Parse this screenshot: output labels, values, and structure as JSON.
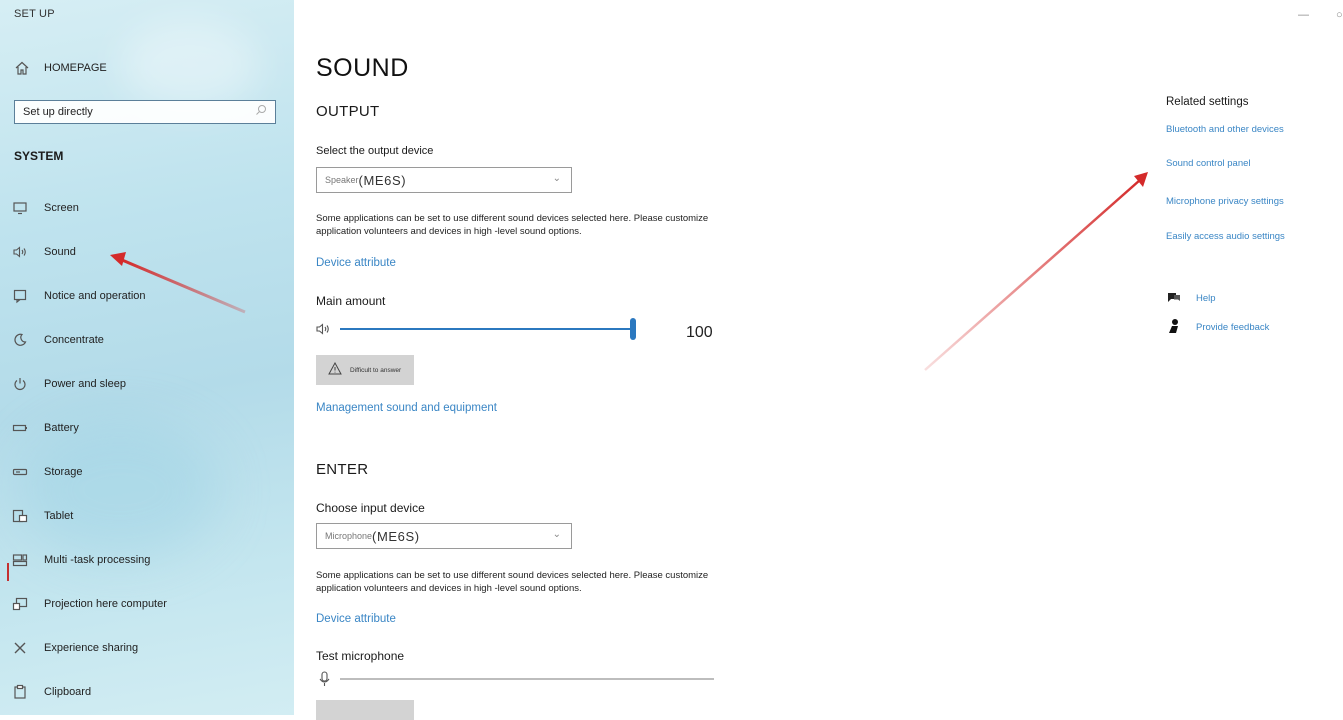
{
  "window": {
    "title": "SET UP",
    "minimize": "—",
    "close": "○"
  },
  "sidebar": {
    "home_label": "HOMEPAGE",
    "search": {
      "placeholder": "Set up directly"
    },
    "section": "SYSTEM",
    "items": [
      {
        "label": "Screen",
        "icon": "monitor-icon"
      },
      {
        "label": "Sound",
        "icon": "speaker-icon"
      },
      {
        "label": "Notice and operation",
        "icon": "notification-icon"
      },
      {
        "label": "Concentrate",
        "icon": "moon-icon"
      },
      {
        "label": "Power and sleep",
        "icon": "power-icon"
      },
      {
        "label": "Battery",
        "icon": "battery-icon"
      },
      {
        "label": "Storage",
        "icon": "storage-icon"
      },
      {
        "label": "Tablet",
        "icon": "tablet-icon"
      },
      {
        "label": "Multi -task processing",
        "icon": "multitask-icon"
      },
      {
        "label": "Projection here computer",
        "icon": "projection-icon"
      },
      {
        "label": "Experience sharing",
        "icon": "share-icon"
      },
      {
        "label": "Clipboard",
        "icon": "clipboard-icon"
      }
    ]
  },
  "main": {
    "title": "SOUND",
    "output": {
      "heading": "OUTPUT",
      "select_label": "Select the output device",
      "device_prefix": "Speaker",
      "device_model": "(ME6S)",
      "description": "Some applications can be set to use different sound devices selected here. Please customize application volunteers and devices in high -level sound options.",
      "device_attribute": "Device attribute",
      "volume_label": "Main amount",
      "volume_value": "100",
      "volume_level": 100,
      "troubleshoot": "Difficult to answer",
      "manage_link": "Management sound and equipment"
    },
    "input": {
      "heading": "ENTER",
      "select_label": "Choose input device",
      "device_prefix": "Microphone",
      "device_model": "(ME6S)",
      "description": "Some applications can be set to use different sound devices selected here. Please customize application volunteers and devices in high -level sound options.",
      "device_attribute": "Device attribute",
      "test_label": "Test microphone",
      "test_level": 0
    }
  },
  "related": {
    "title": "Related settings",
    "links": [
      "Bluetooth and other devices",
      "Sound control panel",
      "Microphone privacy settings",
      "Easily access audio settings"
    ],
    "help": "Help",
    "feedback": "Provide feedback"
  },
  "colors": {
    "accent": "#2b78bf",
    "link": "#3a86c5",
    "annotation": "#d42a2a"
  }
}
